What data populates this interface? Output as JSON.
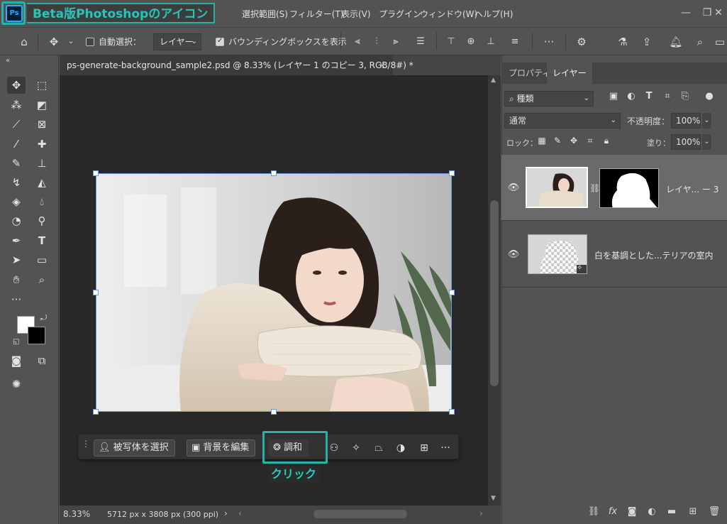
{
  "annotation": {
    "title_label": "Beta版Photoshopのアイコン",
    "click_label": "クリック"
  },
  "app": {
    "logo_text": "Ps"
  },
  "menu": {
    "items": [
      "選択範囲(S)",
      "フィルター(T)",
      "表示(V)",
      "プラグイン",
      "ウィンドウ(W)",
      "ヘルプ(H)"
    ]
  },
  "window_controls": {
    "minimize": "—",
    "restore": "❐",
    "close": "✕"
  },
  "options_bar": {
    "auto_select_label": "自動選択：",
    "auto_select_target": "レイヤー",
    "bounding_box_label": "バウンディングボックスを表示"
  },
  "document": {
    "tab_title": "ps-generate-background_sample2.psd @ 8.33% (レイヤー 1 のコピー 3, RGB/8#) *",
    "close": "×"
  },
  "status": {
    "zoom": "8.33%",
    "dimensions": "5712 px x 3808 px (300 ppi)"
  },
  "taskbar": {
    "select_subject": "被写体を選択",
    "edit_background": "背景を編集",
    "harmonize": "調和"
  },
  "panel": {
    "tabs": [
      "プロパティ",
      "レイヤー"
    ],
    "filter_kind": "種類",
    "blend_mode": "通常",
    "opacity_label": "不透明度：",
    "opacity_value": "100%",
    "lock_label": "ロック：",
    "fill_label": "塗り：",
    "fill_value": "100%",
    "layers": [
      {
        "name": "レイヤ... ー 3"
      },
      {
        "name": "白を基調とした...テリアの室内"
      }
    ]
  },
  "colors": {
    "accent_annotation": "#26b3a6",
    "ui_bg": "#535353",
    "canvas_bg": "#282828",
    "selection": "#6c9ae0"
  }
}
